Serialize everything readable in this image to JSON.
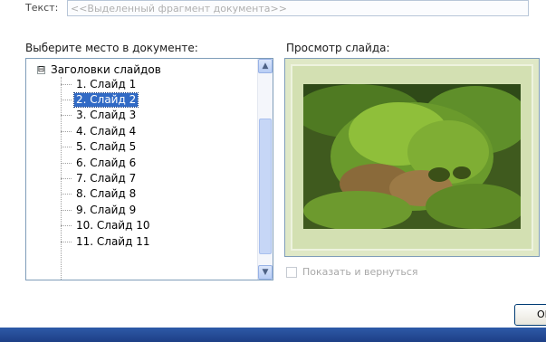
{
  "top_field": {
    "label": "Текст:",
    "value": "<<Выделенный фрагмент документа>>"
  },
  "tree_section": {
    "label": "Выберите место в документе:",
    "root": {
      "label": "Заголовки слайдов",
      "expander": "⊟"
    },
    "items": [
      {
        "label": "1. Слайд 1"
      },
      {
        "label": "2. Слайд 2"
      },
      {
        "label": "3. Слайд 3"
      },
      {
        "label": "4. Слайд 4"
      },
      {
        "label": "5. Слайд 5"
      },
      {
        "label": "6. Слайд 6"
      },
      {
        "label": "7. Слайд 7"
      },
      {
        "label": "8. Слайд 8"
      },
      {
        "label": "9. Слайд 9"
      },
      {
        "label": "10. Слайд 10"
      },
      {
        "label": "11. Слайд 11"
      }
    ],
    "selected_index": 1,
    "scroll_up_icon": "▲",
    "scroll_down_icon": "▼"
  },
  "preview": {
    "label": "Просмотр слайда:"
  },
  "show_and_return": {
    "label": "Показать и вернуться",
    "checked": false
  },
  "ok_button": {
    "label": "OK"
  }
}
